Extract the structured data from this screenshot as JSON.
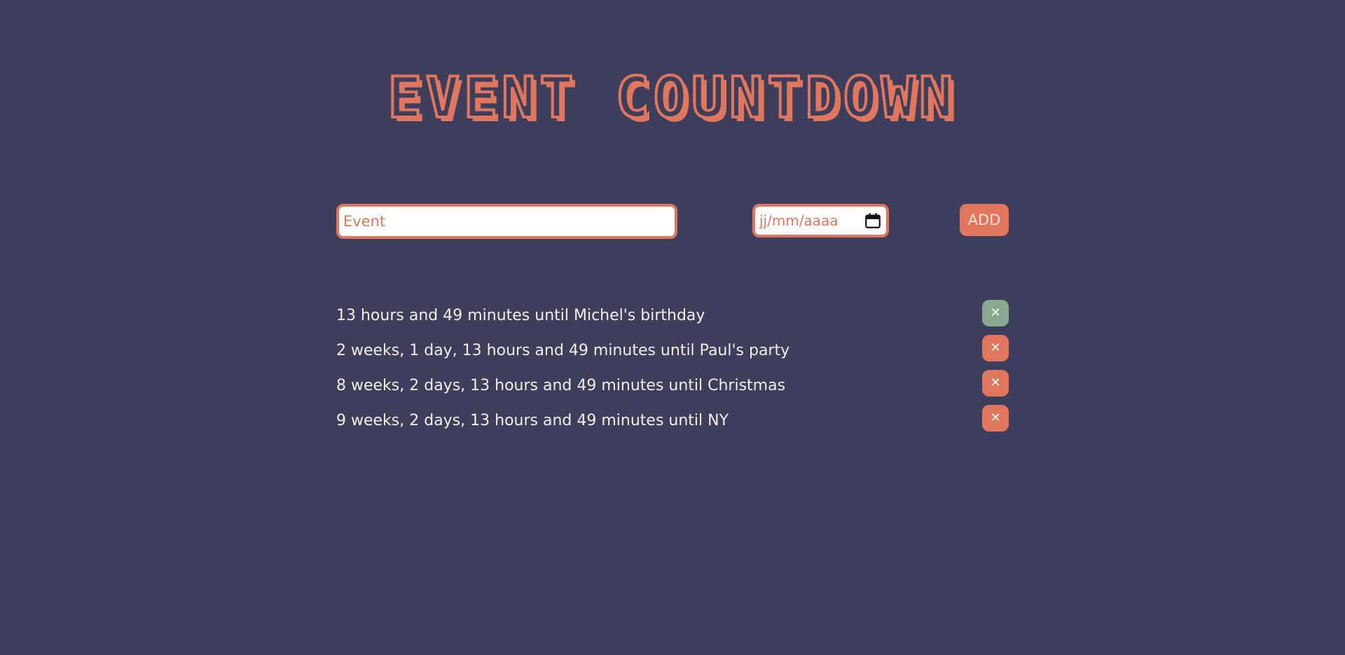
{
  "header": {
    "title": "EVENT COUNTDOWN"
  },
  "form": {
    "event_placeholder": "Event",
    "event_value": "",
    "date_placeholder": "jj/mm/aaaa",
    "add_label": "ADD"
  },
  "events": [
    {
      "text": "13 hours and 49 minutes until Michel's birthday",
      "delete_label": "✕",
      "button_color": "#8aa88f"
    },
    {
      "text": "2 weeks, 1 day, 13 hours and 49 minutes until Paul's party",
      "delete_label": "✕",
      "button_color": "#e2765c"
    },
    {
      "text": "8 weeks, 2 days, 13 hours and 49 minutes until Christmas",
      "delete_label": "✕",
      "button_color": "#e2765c"
    },
    {
      "text": "9 weeks, 2 days, 13 hours and 49 minutes until NY",
      "delete_label": "✕",
      "button_color": "#e2765c"
    }
  ],
  "icons": {
    "calendar": "calendar-icon",
    "delete": "close-icon"
  },
  "colors": {
    "background": "#3d3e5c",
    "accent": "#e2765c",
    "first_delete": "#8aa88f",
    "text": "#f2ede6"
  }
}
